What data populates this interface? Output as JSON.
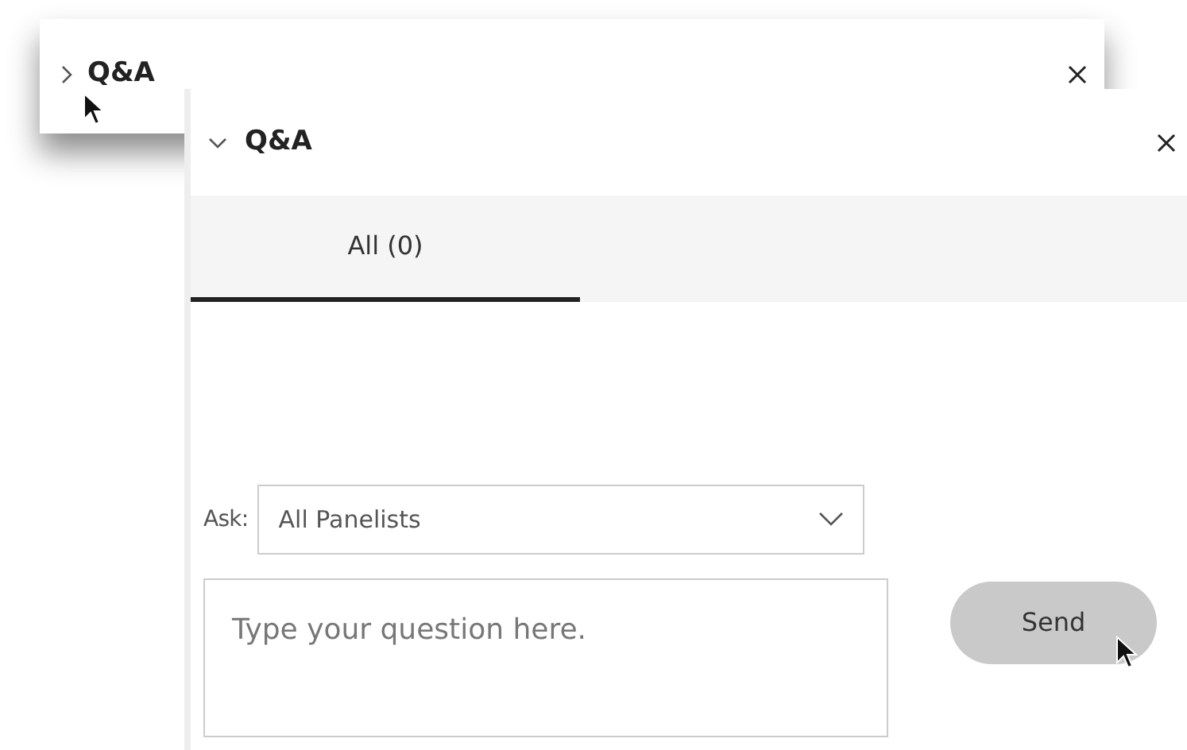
{
  "panels": [
    {
      "title": "Q&A",
      "expanded": false
    },
    {
      "title": "Q&A",
      "expanded": true,
      "tabs": [
        {
          "label": "All (0)",
          "selected": true
        }
      ],
      "ask": {
        "label": "Ask:",
        "value": "All Panelists"
      },
      "question": {
        "placeholder": "Type your question here."
      },
      "send_button": "Send"
    }
  ]
}
